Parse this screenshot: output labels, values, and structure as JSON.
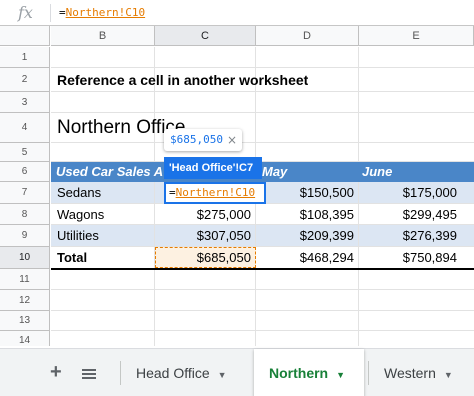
{
  "formula_bar": {
    "fx_label": "fx",
    "eq": "=",
    "ref": "Northern!C10"
  },
  "columns": [
    "B",
    "C",
    "D",
    "E"
  ],
  "rows": [
    "1",
    "2",
    "3",
    "4",
    "5",
    "6",
    "7",
    "8",
    "9",
    "10",
    "11",
    "12",
    "13",
    "14"
  ],
  "selected_column": "C",
  "selected_row": "10",
  "sheet": {
    "title": "Reference a cell in another worksheet",
    "office": "Northern Office",
    "header": {
      "b": "Used Car Sales A",
      "d": "May",
      "e": "June"
    },
    "data_rows": [
      {
        "label": "Sedans",
        "d": "$150,500",
        "e": "$175,000"
      },
      {
        "label": "Wagons",
        "c": "$275,000",
        "d": "$108,395",
        "e": "$299,495"
      },
      {
        "label": "Utilities",
        "c": "$307,050",
        "d": "$209,399",
        "e": "$276,399"
      }
    ],
    "total": {
      "label": "Total",
      "c": "$685,050",
      "d": "$468,294",
      "e": "$750,894"
    }
  },
  "editing_cell": {
    "eq": "=",
    "ref": "Northern!C10"
  },
  "tooltip": {
    "value": "$685,050",
    "close": "×",
    "ref_label": "'Head Office'!C7"
  },
  "tabs": {
    "add": "+",
    "items": [
      {
        "label": "Head Office",
        "active": false
      },
      {
        "label": "Northern",
        "active": true
      },
      {
        "label": "Western",
        "active": false
      }
    ]
  },
  "colors": {
    "header_band": "#4a86c8",
    "row_band": "#dce6f3",
    "selection_blue": "#1a73e8",
    "reference_orange": "#e67c00",
    "active_tab_green": "#188038"
  },
  "icons": [
    "fx-icon",
    "add-sheet-icon",
    "all-sheets-icon",
    "close-icon",
    "tab-menu-caret-icon"
  ]
}
